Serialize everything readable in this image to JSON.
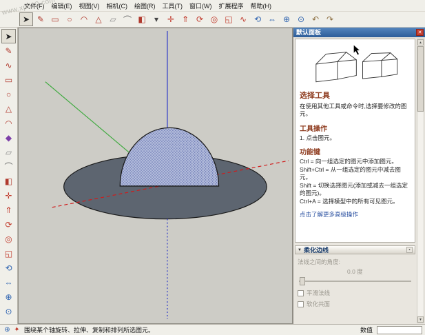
{
  "watermark": "www.xp510.com",
  "menu_bar": {
    "items": [
      {
        "label": "文件(F)"
      },
      {
        "label": "编辑(E)"
      },
      {
        "label": "视图(V)"
      },
      {
        "label": "相机(C)"
      },
      {
        "label": "绘图(R)"
      },
      {
        "label": "工具(T)"
      },
      {
        "label": "窗口(W)"
      },
      {
        "label": "扩展程序"
      },
      {
        "label": "帮助(H)"
      }
    ]
  },
  "toolbar_top": {
    "icons": [
      {
        "name": "select-tool-icon",
        "glyph": "➤",
        "color": "#222222"
      },
      {
        "name": "line-tool-icon",
        "glyph": "✎",
        "color": "#b03a2e"
      },
      {
        "name": "rectangle-tool-icon",
        "glyph": "▭",
        "color": "#b03a2e"
      },
      {
        "name": "circle-tool-icon",
        "glyph": "○",
        "color": "#b03a2e"
      },
      {
        "name": "arc-tool-icon",
        "glyph": "◠",
        "color": "#b03a2e"
      },
      {
        "name": "polygon-tool-icon",
        "glyph": "△",
        "color": "#b03a2e"
      },
      {
        "name": "eraser-tool-icon",
        "glyph": "▱",
        "color": "#8a8a8a"
      },
      {
        "name": "tape-measure-tool-icon",
        "glyph": "⌒",
        "color": "#666666"
      },
      {
        "name": "paint-bucket-tool-icon",
        "glyph": "◧",
        "color": "#b03a2e"
      },
      {
        "name": "styles-dropdown-icon",
        "glyph": "▾",
        "color": "#444444"
      },
      {
        "name": "move-tool-icon",
        "glyph": "✛",
        "color": "#c0392b"
      },
      {
        "name": "push-pull-tool-icon",
        "glyph": "⇑",
        "color": "#c0392b"
      },
      {
        "name": "rotate-tool-icon",
        "glyph": "⟳",
        "color": "#c0392b"
      },
      {
        "name": "offset-tool-icon",
        "glyph": "◎",
        "color": "#c0392b"
      },
      {
        "name": "scale-tool-icon",
        "glyph": "◱",
        "color": "#c0392b"
      },
      {
        "name": "follow-me-tool-icon",
        "glyph": "∿",
        "color": "#c0392b"
      },
      {
        "name": "orbit-tool-icon",
        "glyph": "⟲",
        "color": "#2e63b0"
      },
      {
        "name": "pan-tool-icon",
        "glyph": "⇔",
        "color": "#2e63b0"
      },
      {
        "name": "zoom-tool-icon",
        "glyph": "⊕",
        "color": "#2e63b0"
      },
      {
        "name": "zoom-extents-tool-icon",
        "glyph": "⊙",
        "color": "#2e63b0"
      },
      {
        "name": "undo-icon",
        "glyph": "↶",
        "color": "#8b6d3f"
      },
      {
        "name": "redo-icon",
        "glyph": "↷",
        "color": "#8b6d3f"
      }
    ]
  },
  "toolbar_left": {
    "icons": [
      {
        "name": "select-tool-icon",
        "glyph": "➤",
        "color": "#222222"
      },
      {
        "name": "line-tool-icon",
        "glyph": "✎",
        "color": "#b03a2e"
      },
      {
        "name": "freehand-tool-icon",
        "glyph": "∿",
        "color": "#b03a2e"
      },
      {
        "name": "rectangle-tool-icon",
        "glyph": "▭",
        "color": "#b03a2e"
      },
      {
        "name": "circle-tool-icon",
        "glyph": "○",
        "color": "#b03a2e"
      },
      {
        "name": "polygon-tool-icon",
        "glyph": "△",
        "color": "#b03a2e"
      },
      {
        "name": "arc-tool-icon",
        "glyph": "◠",
        "color": "#b03a2e"
      },
      {
        "name": "make-component-icon",
        "glyph": "◆",
        "color": "#7d3fa8"
      },
      {
        "name": "eraser-tool-icon",
        "glyph": "▱",
        "color": "#8a8a8a"
      },
      {
        "name": "tape-measure-tool-icon",
        "glyph": "⌒",
        "color": "#666666"
      },
      {
        "name": "paint-bucket-tool-icon",
        "glyph": "◧",
        "color": "#b03a2e"
      },
      {
        "name": "move-tool-icon",
        "glyph": "✛",
        "color": "#c0392b"
      },
      {
        "name": "push-pull-tool-icon",
        "glyph": "⇑",
        "color": "#c0392b"
      },
      {
        "name": "rotate-tool-icon",
        "glyph": "⟳",
        "color": "#c0392b"
      },
      {
        "name": "offset-tool-icon",
        "glyph": "◎",
        "color": "#c0392b"
      },
      {
        "name": "scale-tool-icon",
        "glyph": "◱",
        "color": "#c0392b"
      },
      {
        "name": "orbit-tool-icon",
        "glyph": "⟲",
        "color": "#2e63b0"
      },
      {
        "name": "pan-tool-icon",
        "glyph": "⇔",
        "color": "#2e63b0"
      },
      {
        "name": "zoom-tool-icon",
        "glyph": "⊕",
        "color": "#2e63b0"
      },
      {
        "name": "zoom-extents-tool-icon",
        "glyph": "⊙",
        "color": "#2e63b0"
      }
    ]
  },
  "viewport": {
    "background": "#cdccc6",
    "axes": {
      "red": "#d01b1b",
      "green": "#3faa3f",
      "blue": "#2a35c8"
    },
    "model": {
      "disk_fill": "#5d6570",
      "disk_stroke": "#1a1a1a",
      "dome_fill": "#b3bcdb",
      "dome_dot": "#5463a8",
      "dome_stroke": "#1a1a1a"
    }
  },
  "right_panel": {
    "title": "默认面板",
    "close_icon": "✕",
    "scrollbar": {
      "up": "▲",
      "down": "▼"
    },
    "instructor": {
      "tool_title": "选择工具",
      "intro": "在使用其他工具或命令时,选择要修改的图元。",
      "operations_title": "工具操作",
      "operations": [
        {
          "text": "1. 点击图元。"
        }
      ],
      "modifiers_title": "功能键",
      "modifiers": [
        {
          "text": "Ctrl = 向一组选定的图元中添加图元。"
        },
        {
          "text": "Shift+Ctrl = 从一组选定的图元中减去图元。"
        },
        {
          "text": "Shift = 切换选择图元(添加或减去一组选定的图元)。"
        },
        {
          "text": "Ctrl+A = 选择模型中的所有可见图元。"
        }
      ],
      "more_link": "点击了解更多高级操作"
    },
    "soften_edges": {
      "title": "柔化边线",
      "collapse_icon": "▼",
      "pin_icon": "▪",
      "angle_label": "法线之间的角度:",
      "angle_value": "0.0 度",
      "smooth_normals_label": "平滑法线",
      "soften_coplanar_label": "软化共面"
    }
  },
  "status_bar": {
    "icons": [
      {
        "name": "geolocation-icon",
        "glyph": "⊕",
        "color": "#2e63b0"
      },
      {
        "name": "credits-icon",
        "glyph": "✦",
        "color": "#c0392b"
      }
    ],
    "hint": "围绕某个轴旋转、拉伸、复制和排列所选图元。",
    "value_label": "数值",
    "value_input": ""
  }
}
